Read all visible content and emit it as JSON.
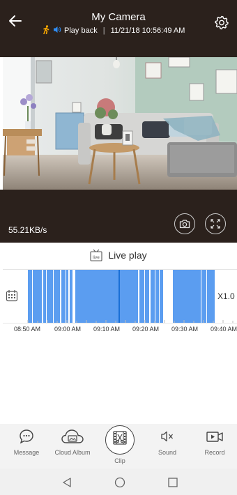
{
  "header": {
    "title": "My Camera",
    "mode_label": "Play back",
    "separator": "|",
    "datetime": "11/21/18 10:56:49 AM"
  },
  "video": {
    "rate": "55.21KB/s"
  },
  "live": {
    "label": "Live play",
    "icon_text": "live"
  },
  "timeline": {
    "labels": [
      "08:50 AM",
      "09:00 AM",
      "09:10 AM",
      "09:20 AM",
      "09:30 AM",
      "09:40 AM"
    ],
    "speed": "X1.0",
    "recording_color": "#5b9df0",
    "cursor_color": "#1a6fd6"
  },
  "toolbar": {
    "items": [
      {
        "label": "Message"
      },
      {
        "label": "Cloud Album"
      },
      {
        "label": "Clip"
      },
      {
        "label": "Sound"
      },
      {
        "label": "Record"
      }
    ]
  },
  "colors": {
    "header_bg": "#2b211c",
    "accent_orange": "#f7a600",
    "accent_blue": "#2e8df6"
  }
}
